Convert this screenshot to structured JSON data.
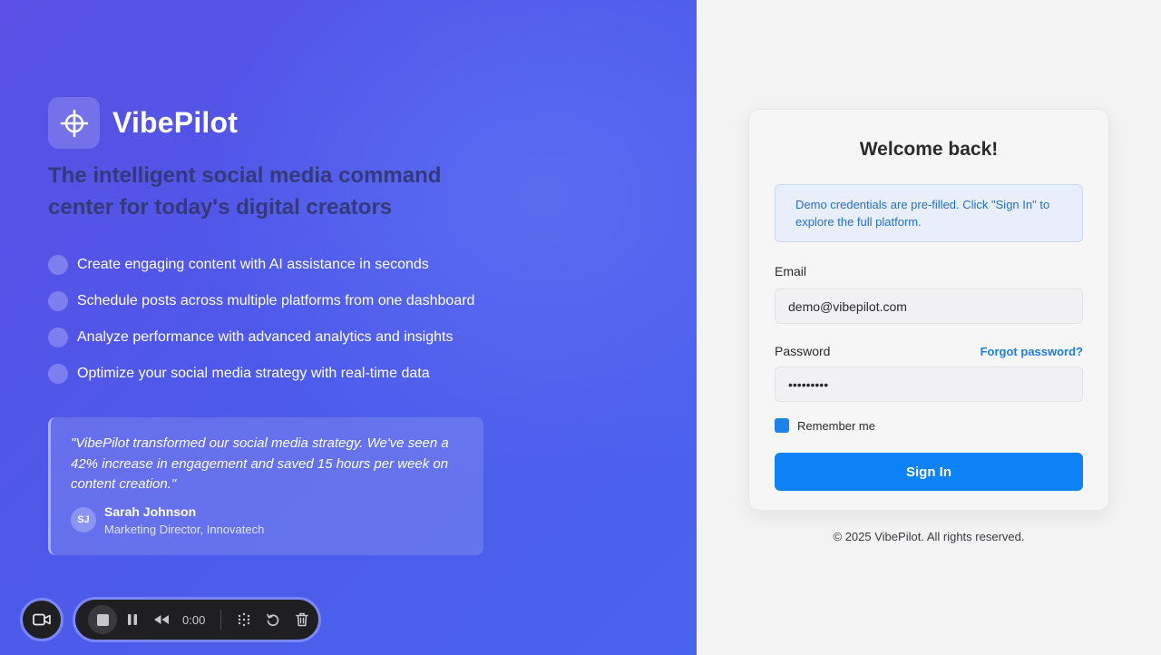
{
  "brand": {
    "name": "VibePilot",
    "logo_icon": "crosshair-icon"
  },
  "tagline": "The intelligent social media command center for today's digital creators",
  "features": [
    "Create engaging content with AI assistance in seconds",
    "Schedule posts across multiple platforms from one dashboard",
    "Analyze performance with advanced analytics and insights",
    "Optimize your social media strategy with real-time data"
  ],
  "testimonial": {
    "quote": "\"VibePilot transformed our social media strategy. We've seen a 42% increase in engagement and saved 15 hours per week on content creation.\"",
    "initials": "SJ",
    "name": "Sarah Johnson",
    "role": "Marketing Director, Innovatech"
  },
  "recorder": {
    "time": "0:00"
  },
  "login": {
    "title": "Welcome back!",
    "notice": "Demo credentials are pre-filled. Click \"Sign In\" to explore the full platform.",
    "email_label": "Email",
    "email_value": "demo@vibepilot.com",
    "password_label": "Password",
    "password_value": "vibepilot",
    "forgot_label": "Forgot password?",
    "remember_label": "Remember me",
    "remember_checked": true,
    "signin_label": "Sign In"
  },
  "footer": "© 2025 VibePilot. All rights reserved.",
  "colors": {
    "accent": "#0d82f6",
    "panel_gradient_start": "#5a4fe4",
    "panel_gradient_end": "#4a63ee"
  }
}
